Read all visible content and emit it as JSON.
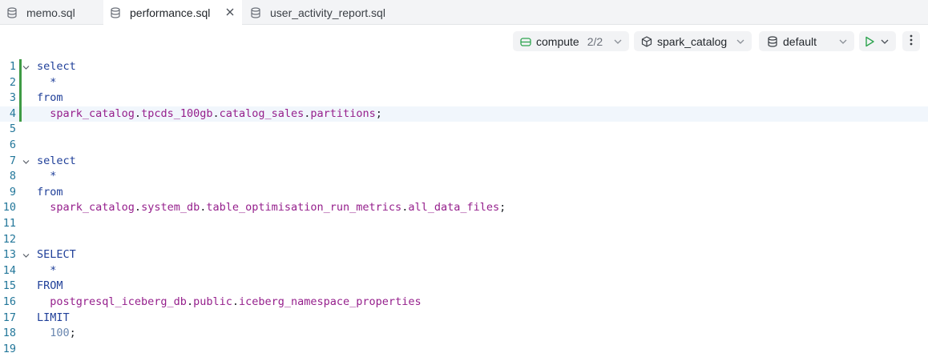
{
  "tabs": [
    {
      "label": "memo.sql",
      "active": false,
      "icon": "database-icon"
    },
    {
      "label": "performance.sql",
      "active": true,
      "icon": "database-icon"
    },
    {
      "label": "user_activity_report.sql",
      "active": false,
      "icon": "database-icon"
    }
  ],
  "toolbar": {
    "compute_label": "compute",
    "compute_count": "2/2",
    "catalog_label": "spark_catalog",
    "schema_label": "default"
  },
  "colors": {
    "keyword": "#1f3f99",
    "identifier": "#951f8c",
    "line_number": "#23779a",
    "run_green": "#2ea44f",
    "modified_bar": "#3f9b45"
  },
  "editor": {
    "lines": [
      {
        "n": "1",
        "tokens": [
          [
            "kw",
            "select"
          ]
        ]
      },
      {
        "n": "2",
        "tokens": [
          [
            "op",
            "  *"
          ]
        ]
      },
      {
        "n": "3",
        "tokens": [
          [
            "kw",
            "from"
          ]
        ]
      },
      {
        "n": "4",
        "tokens": [
          [
            "id",
            "  spark_catalog"
          ],
          [
            "pl",
            "."
          ],
          [
            "id",
            "tpcds_100gb"
          ],
          [
            "pl",
            "."
          ],
          [
            "id",
            "catalog_sales"
          ],
          [
            "pl",
            "."
          ],
          [
            "id",
            "partitions"
          ],
          [
            "pl",
            ";"
          ]
        ]
      },
      {
        "n": "5",
        "tokens": []
      },
      {
        "n": "6",
        "tokens": []
      },
      {
        "n": "7",
        "tokens": [
          [
            "kw",
            "select"
          ]
        ]
      },
      {
        "n": "8",
        "tokens": [
          [
            "op",
            "  *"
          ]
        ]
      },
      {
        "n": "9",
        "tokens": [
          [
            "kw",
            "from"
          ]
        ]
      },
      {
        "n": "10",
        "tokens": [
          [
            "id",
            "  spark_catalog"
          ],
          [
            "pl",
            "."
          ],
          [
            "id",
            "system_db"
          ],
          [
            "pl",
            "."
          ],
          [
            "id",
            "table_optimisation_run_metrics"
          ],
          [
            "pl",
            "."
          ],
          [
            "id",
            "all_data_files"
          ],
          [
            "pl",
            ";"
          ]
        ]
      },
      {
        "n": "11",
        "tokens": []
      },
      {
        "n": "12",
        "tokens": []
      },
      {
        "n": "13",
        "tokens": [
          [
            "kw",
            "SELECT"
          ]
        ]
      },
      {
        "n": "14",
        "tokens": [
          [
            "op",
            "  *"
          ]
        ]
      },
      {
        "n": "15",
        "tokens": [
          [
            "kw",
            "FROM"
          ]
        ]
      },
      {
        "n": "16",
        "tokens": [
          [
            "id",
            "  postgresql_iceberg_db"
          ],
          [
            "pl",
            "."
          ],
          [
            "id",
            "public"
          ],
          [
            "pl",
            "."
          ],
          [
            "id",
            "iceberg_namespace_properties"
          ]
        ]
      },
      {
        "n": "17",
        "tokens": [
          [
            "kw",
            "LIMIT"
          ]
        ]
      },
      {
        "n": "18",
        "tokens": [
          [
            "num",
            "  100"
          ],
          [
            "pl",
            ";"
          ]
        ]
      },
      {
        "n": "19",
        "tokens": []
      }
    ]
  }
}
